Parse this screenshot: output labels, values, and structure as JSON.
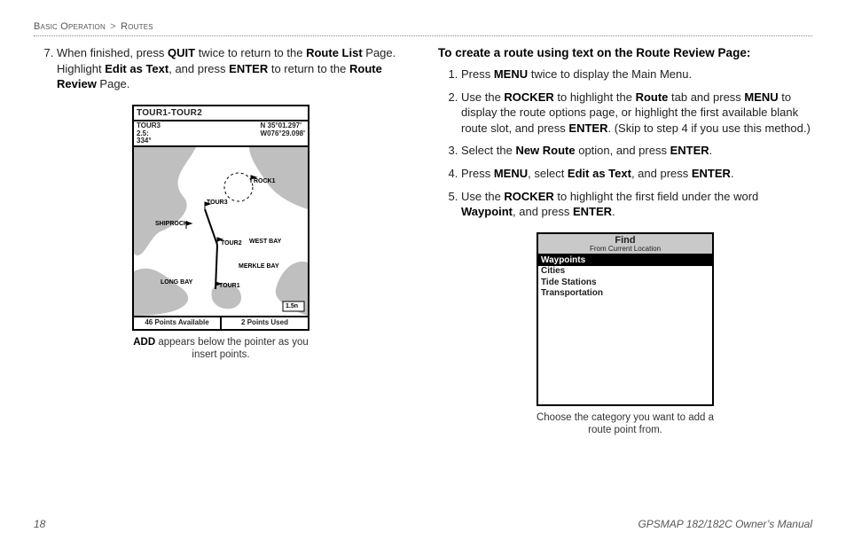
{
  "breadcrumb": {
    "section": "Basic Operation",
    "sep": ">",
    "sub": "Routes"
  },
  "left": {
    "step7_a": "When finished, press ",
    "step7_b": " twice to return to the ",
    "step7_c": " Page. Highlight ",
    "step7_d": ", and press ",
    "step7_e": " to return to the ",
    "step7_f": " Page.",
    "kw": {
      "quit": "QUIT",
      "routelist": "Route List",
      "editastext": "Edit as Text",
      "enter": "ENTER",
      "routereview": "Route Review"
    },
    "fig": {
      "title": "TOUR1-TOUR2",
      "info_left": "TOUR3\n2.5:\n334°",
      "info_right": "N 35°01.297'\nW076°29.098'",
      "labels": {
        "rock1": "ROCK1",
        "tour3": "TOUR3",
        "shiprock": "SHIPROCK",
        "tour2": "TOUR2",
        "westbay": "WEST BAY",
        "merkle": "MERKLE BAY",
        "longbay": "LONG BAY",
        "tour1": "TOUR1",
        "scale": "1.5n"
      },
      "status_left": "46 Points Available",
      "status_right": "2 Points Used"
    },
    "caption_a": "ADD",
    "caption_b": " appears below the pointer as you insert points."
  },
  "right": {
    "heading": "To create a route using text on the Route Review Page:",
    "s1_a": "Press ",
    "s1_b": " twice to display the Main Menu.",
    "s2_a": "Use the ",
    "s2_b": " to highlight the ",
    "s2_c": " tab and press ",
    "s2_d": " to display the route options page, or highlight the first available blank route slot, and press ",
    "s2_e": ". (Skip to step 4 if you use this method.)",
    "s3_a": "Select the ",
    "s3_b": " option, and press ",
    "s3_c": ".",
    "s4_a": "Press ",
    "s4_b": ", select ",
    "s4_c": ", and press ",
    "s4_d": ".",
    "s5_a": "Use the ",
    "s5_b": " to highlight the first field under the word ",
    "s5_c": ", and press ",
    "s5_d": ".",
    "kw": {
      "menu": "MENU",
      "rocker": "ROCKER",
      "route": "Route",
      "enter": "ENTER",
      "newroute": "New Route",
      "editastext": "Edit as Text",
      "waypoint": "Waypoint"
    },
    "fig": {
      "title": "Find",
      "subtitle": "From Current Location",
      "items": [
        "Waypoints",
        "Cities",
        "Tide Stations",
        "Transportation"
      ]
    },
    "caption": "Choose the category you want to add a route point from."
  },
  "footer": {
    "page": "18",
    "manual": "GPSMAP 182/182C Owner’s Manual"
  }
}
